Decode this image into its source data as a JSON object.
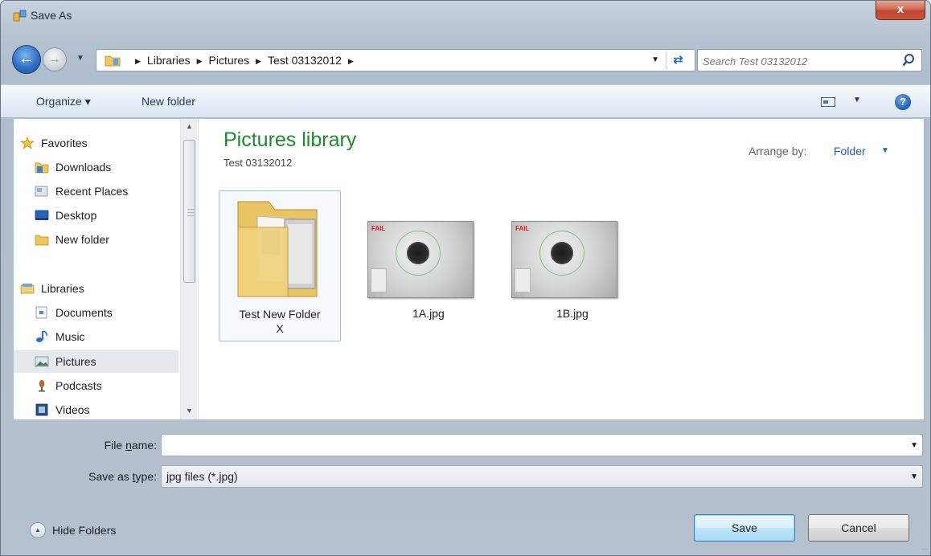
{
  "window": {
    "title": "Save As",
    "close_glyph": "x"
  },
  "address": {
    "crumbs": [
      "Libraries",
      "Pictures",
      "Test 03132012"
    ],
    "search_placeholder": "Search Test 03132012"
  },
  "toolbar": {
    "organize": "Organize ▾",
    "new_folder": "New folder",
    "help": "?"
  },
  "nav": {
    "favorites": "Favorites",
    "downloads": "Downloads",
    "recent_places": "Recent Places",
    "desktop": "Desktop",
    "new_folder": "New folder",
    "libraries": "Libraries",
    "documents": "Documents",
    "music": "Music",
    "pictures": "Pictures",
    "podcasts": "Podcasts",
    "videos": "Videos",
    "selected": "Pictures"
  },
  "content": {
    "library_title": "Pictures library",
    "library_subtitle": "Test 03132012",
    "arrange_label": "Arrange by:",
    "arrange_value": "Folder",
    "items": [
      {
        "name_line1": "Test New Folder",
        "name_line2": "X",
        "kind": "folder"
      },
      {
        "name": "1A.jpg",
        "kind": "image",
        "badge": "FAIL"
      },
      {
        "name": "1B.jpg",
        "kind": "image",
        "badge": "FAIL"
      }
    ]
  },
  "form": {
    "file_name_label_pre": "File ",
    "file_name_label_u": "n",
    "file_name_label_post": "ame:",
    "file_name_value": "",
    "save_type_label_pre": "Save as ",
    "save_type_label_u": "t",
    "save_type_label_post": "ype:",
    "save_type_value": "jpg files (*.jpg)"
  },
  "footer": {
    "hide_folders": "Hide Folders",
    "save": "Save",
    "cancel": "Cancel"
  },
  "colors": {
    "library_title": "#1e8b2d",
    "link_blue": "#1e63b4",
    "fail_red": "#e01d1d"
  }
}
